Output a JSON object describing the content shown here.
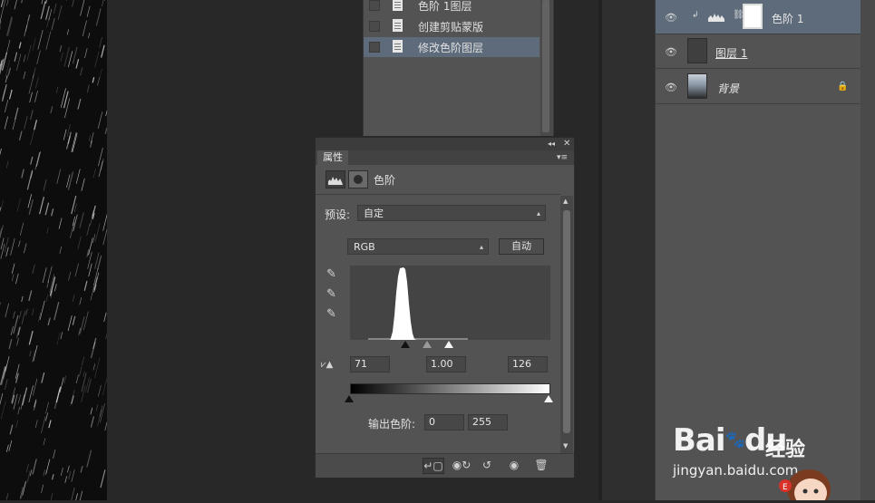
{
  "history": {
    "items": [
      {
        "label": "色阶 1图层",
        "active": false
      },
      {
        "label": "创建剪贴蒙版",
        "active": false
      },
      {
        "label": "修改色阶图层",
        "active": true
      }
    ]
  },
  "properties": {
    "tab_label": "属性",
    "title": "色阶",
    "preset_label": "预设:",
    "preset_value": "自定",
    "channel_value": "RGB",
    "auto_button": "自动",
    "input_black": "71",
    "input_gamma": "1.00",
    "input_white": "126",
    "output_label": "输出色阶:",
    "output_black": "0",
    "output_white": "255"
  },
  "layers": {
    "items": [
      {
        "name": "色阶 1",
        "selected": true,
        "locked": false
      },
      {
        "name": "图层 1",
        "selected": false,
        "locked": false
      },
      {
        "name": "背景",
        "selected": false,
        "locked": true
      }
    ]
  },
  "watermark": {
    "brand": "Bai",
    "brand_tail": "du",
    "product": "经验",
    "url": "jingyan.baidu.com"
  },
  "colors": {
    "panel": "#535353",
    "selected": "#5d6b7b",
    "canvas": "#282828"
  }
}
